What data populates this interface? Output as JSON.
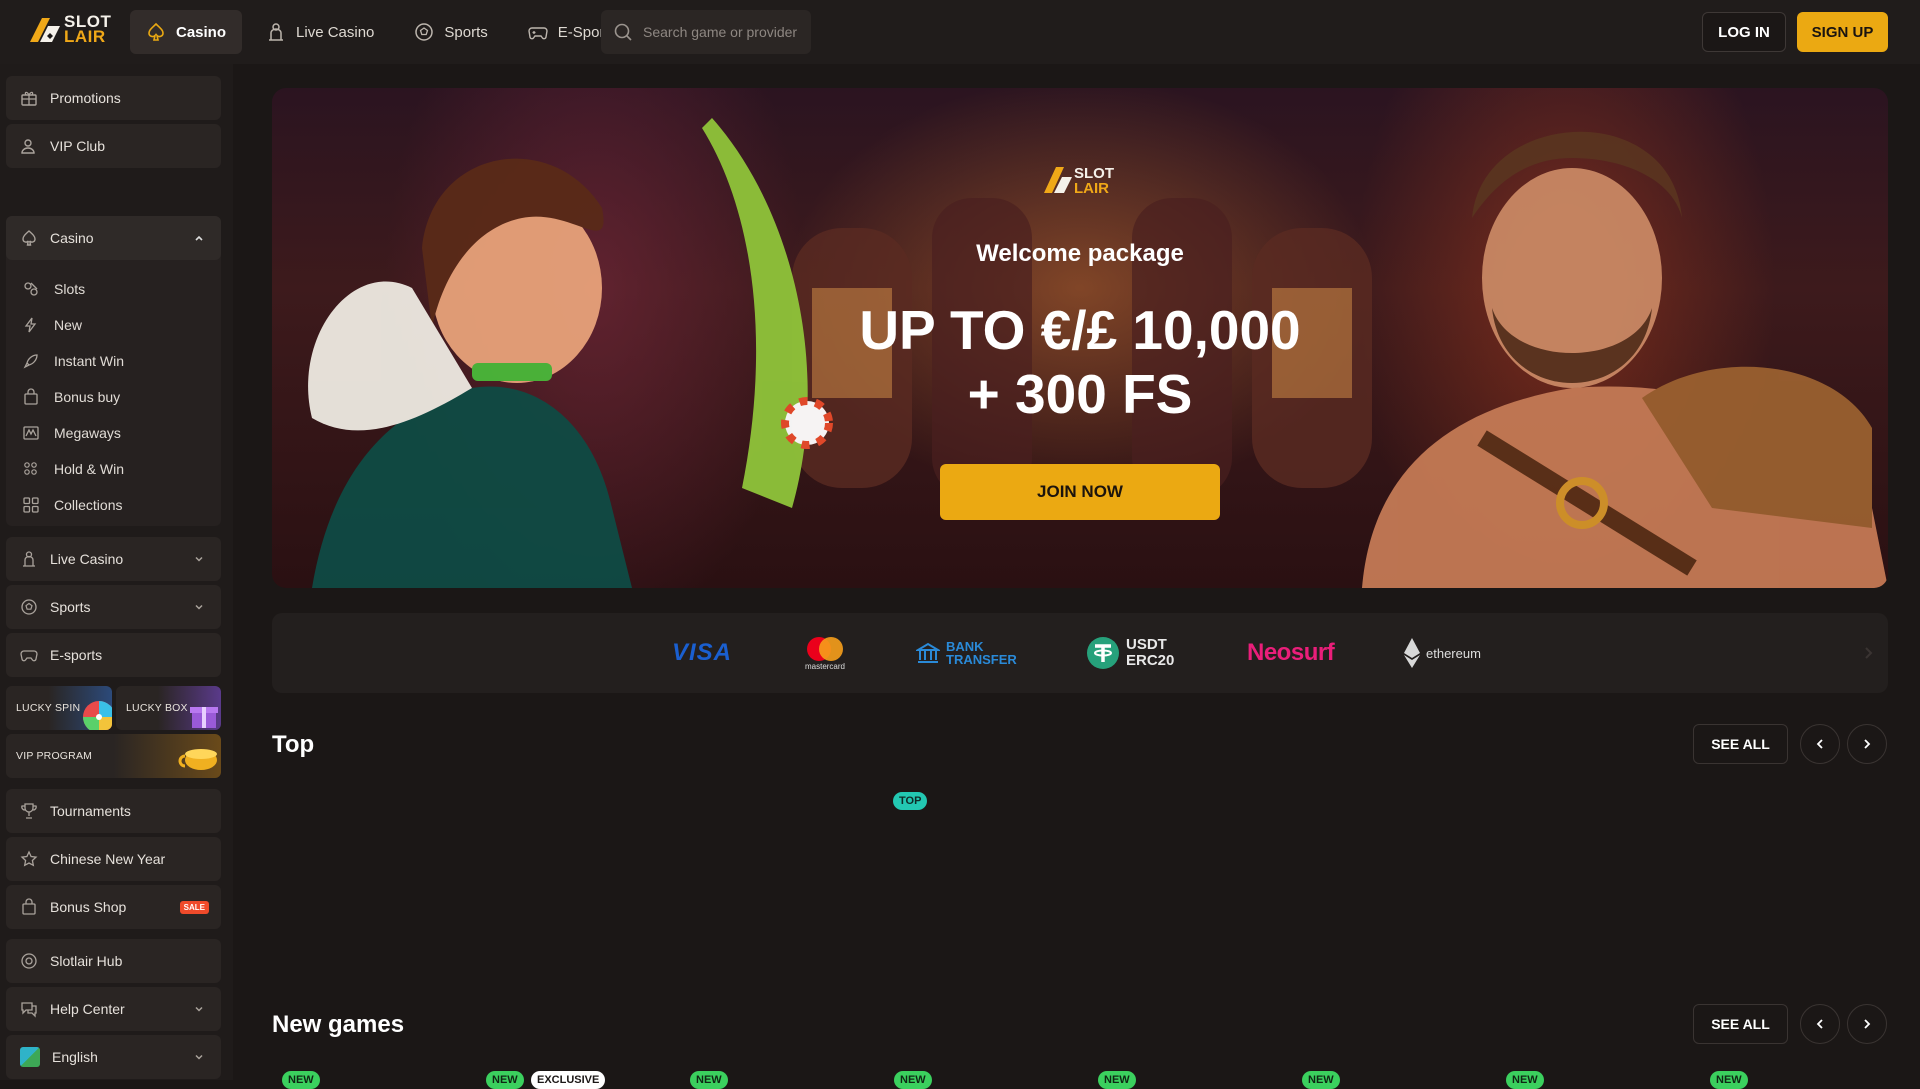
{
  "brand": {
    "line1": "SLOT",
    "line2": "LAIR"
  },
  "nav": [
    {
      "label": "Casino",
      "icon": "spade-icon",
      "active": true
    },
    {
      "label": "Live Casino",
      "icon": "dealer-icon"
    },
    {
      "label": "Sports",
      "icon": "soccer-ball-icon"
    },
    {
      "label": "E-Sports",
      "icon": "gamepad-icon"
    }
  ],
  "search": {
    "placeholder": "Search game or provider"
  },
  "auth": {
    "login": "LOG IN",
    "signup": "SIGN UP"
  },
  "sidebar": {
    "promotions": "Promotions",
    "vip_club": "VIP Club",
    "casino": "Casino",
    "casino_sub": [
      "Slots",
      "New",
      "Instant Win",
      "Bonus buy",
      "Megaways",
      "Hold & Win",
      "Collections"
    ],
    "live_casino": "Live Casino",
    "sports": "Sports",
    "esports": "E-sports",
    "lucky_spin": "LUCKY SPIN",
    "lucky_box": "LUCKY BOX",
    "vip_program": "VIP PROGRAM",
    "tournaments": "Tournaments",
    "chinese_new_year": "Chinese New Year",
    "bonus_shop": "Bonus Shop",
    "sale_badge": "SALE",
    "slotlair_hub": "Slotlair Hub",
    "help_center": "Help Center",
    "language": "English"
  },
  "hero": {
    "subtitle": "Welcome package",
    "title_line1": "UP TO €/£ 10,000",
    "title_line2": "+ 300 FS",
    "cta": "JOIN NOW"
  },
  "payments": [
    "VISA",
    "mastercard",
    "BANK TRANSFER",
    "USDT ERC20",
    "Neosurf",
    "ethereum"
  ],
  "sections": {
    "top": {
      "title": "Top",
      "see_all": "SEE ALL",
      "tag": "TOP"
    },
    "new_games": {
      "title": "New games",
      "see_all": "SEE ALL",
      "tag_new": "NEW",
      "tag_exclusive": "EXCLUSIVE"
    }
  },
  "colors": {
    "accent": "#eba912",
    "background": "#1b1716",
    "panel": "#2a2523",
    "top_tag": "#23c8b2",
    "new_tag": "#3bd05e",
    "sale": "#ef4a2a"
  }
}
